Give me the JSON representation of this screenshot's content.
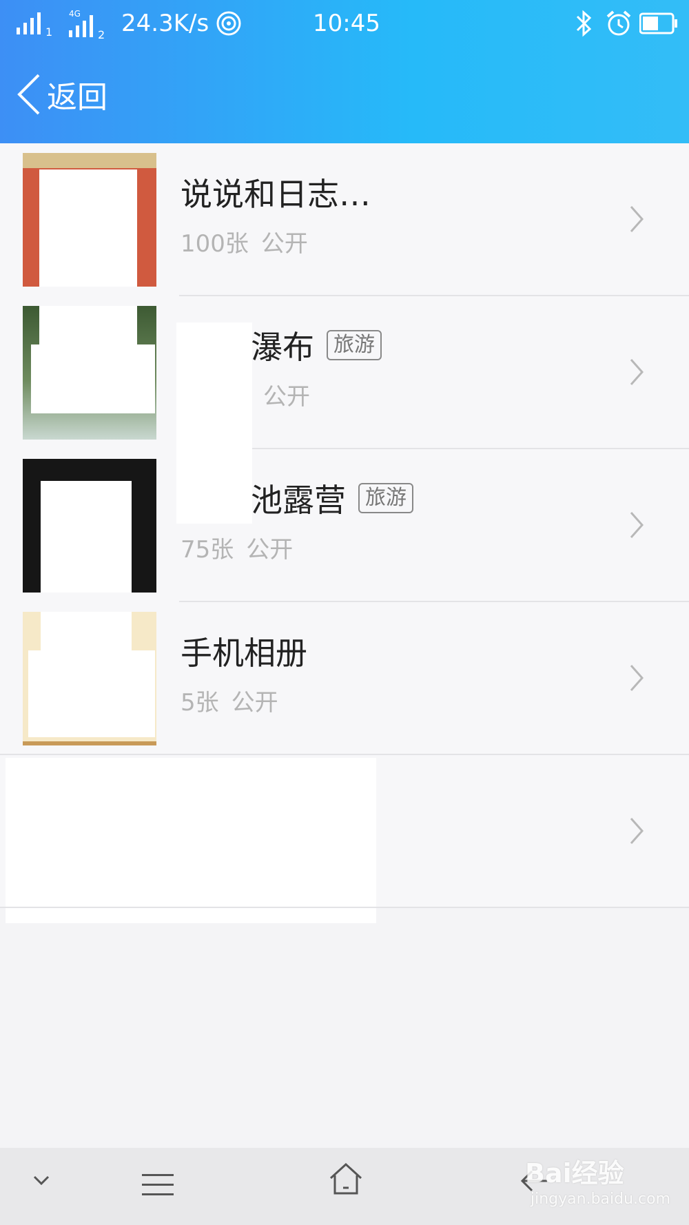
{
  "status_bar": {
    "network_type": "4G",
    "sim1": "1",
    "sim2": "2",
    "speed": "24.3K/s",
    "time": "10:45",
    "icons": [
      "signal-icon",
      "wifi-icon",
      "bluetooth-icon",
      "alarm-icon",
      "battery-icon"
    ]
  },
  "nav": {
    "back_label": "返回"
  },
  "albums": [
    {
      "title": "说说和日志…",
      "count": "100张",
      "privacy": "公开",
      "tag": ""
    },
    {
      "title": "瀑布",
      "count": "",
      "privacy": "公开",
      "tag": "旅游"
    },
    {
      "title": "池露营",
      "count": "75张",
      "privacy": "公开",
      "tag": "旅游"
    },
    {
      "title": "手机相册",
      "count": "5张",
      "privacy": "公开",
      "tag": ""
    },
    {
      "title": "",
      "count": "",
      "privacy": "",
      "tag": ""
    }
  ],
  "bottom_nav": {
    "icons": [
      "chevron-down-icon",
      "menu-icon",
      "home-icon",
      "back-icon"
    ]
  },
  "watermark": {
    "brand": "Bai经验",
    "url": "jingyan.baidu.com"
  },
  "colors": {
    "header_start": "#3d8ff5",
    "header_end": "#26baf9",
    "background": "#f4f4f6"
  }
}
